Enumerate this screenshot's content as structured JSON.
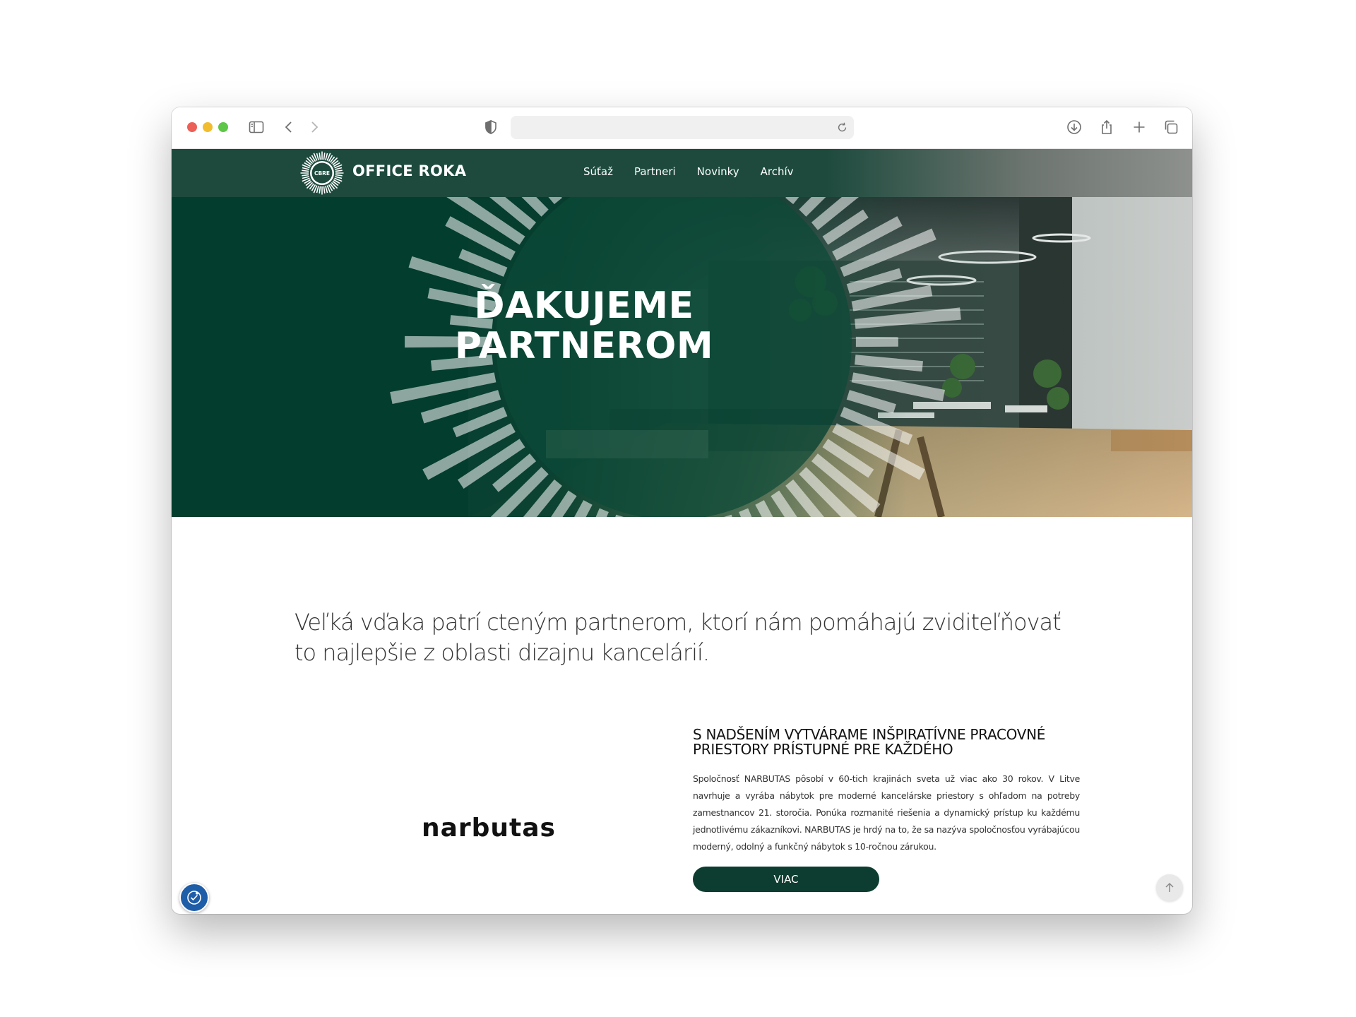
{
  "browser": {
    "url": "",
    "icons": [
      "sidebar-icon",
      "back-icon",
      "forward-icon",
      "shield-icon",
      "reload-icon",
      "download-icon",
      "share-icon",
      "new-tab-icon",
      "tabs-overview-icon"
    ]
  },
  "site": {
    "logo_badge": "CBRE",
    "brand": "OFFICE ROKA",
    "nav": [
      {
        "label": "Súťaž"
      },
      {
        "label": "Partneri"
      },
      {
        "label": "Novinky"
      },
      {
        "label": "Archív"
      }
    ]
  },
  "hero": {
    "title_line1": "ĎAKUJEME",
    "title_line2": "PARTNEROM"
  },
  "intro": "Veľká vďaka patrí cteným partnerom, ktorí nám pomáhajú zviditeľňovať to najlepšie z oblasti dizajnu kancelárií.",
  "partner": {
    "logo_text": "narbutas",
    "heading": "S NADŠENÍM VYTVÁRAME INŠPIRATÍVNE PRACOVNÉ PRIESTORY PRÍSTUPNÉ PRE KAŽDÉHO",
    "description": "Spoločnosť NARBUTAS pôsobí v 60-tich krajinách sveta už viac ako 30 rokov. V Litve navrhuje a vyrába nábytok pre moderné kancelárske priestory s ohľadom na potreby zamestnancov 21. storočia. Ponúka rozmanité riešenia a dynamický prístup ku každému jednotlivému zákazníkovi. NARBUTAS je hrdý na to, že sa nazýva spoločnosťou vyrábajúcou moderný, odolný a funkčný nábytok s 10-ročnou zárukou.",
    "button": "VIAC"
  },
  "colors": {
    "brand_green": "#033d2d",
    "header_green": "#1d4a3d",
    "button_green": "#0d3d30",
    "accessibility_blue": "#1e5da8"
  }
}
